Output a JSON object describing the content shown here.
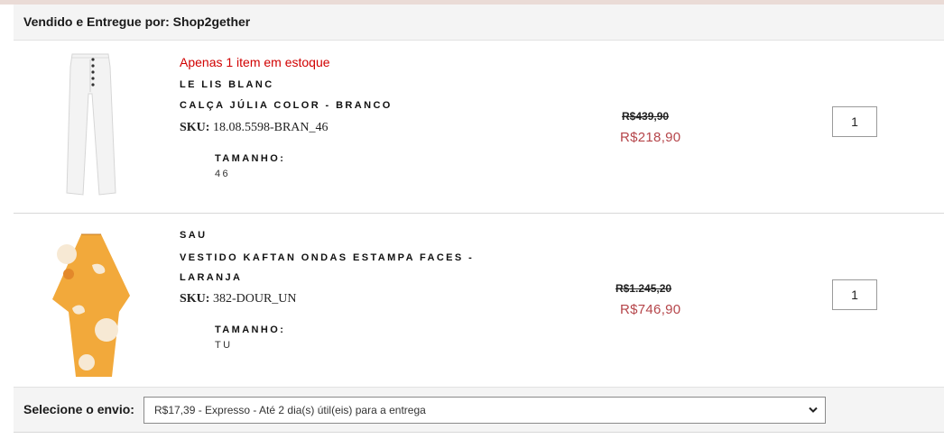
{
  "seller": {
    "label": "Vendido e Entregue por: Shop2gether"
  },
  "items": [
    {
      "stock_message": "Apenas 1 item em estoque",
      "brand": "LE LIS BLANC",
      "name": "CALÇA JÚLIA COLOR - BRANCO",
      "sku_label": "SKU:",
      "sku_value": "18.08.5598-BRAN_46",
      "size_label": "TAMANHO:",
      "size_value": "46",
      "old_price": "R$439,90",
      "new_price": "R$218,90",
      "quantity": "1",
      "image_icon": "white-pants-icon"
    },
    {
      "brand": "SAU",
      "name": "VESTIDO KAFTAN ONDAS ESTAMPA FACES - LARANJA",
      "sku_label": "SKU:",
      "sku_value": "382-DOUR_UN",
      "size_label": "TAMANHO:",
      "size_value": "TU",
      "old_price": "R$1.245,20",
      "new_price": "R$746,90",
      "quantity": "1",
      "image_icon": "orange-kaftan-icon"
    }
  ],
  "shipping": {
    "label": "Selecione o envio:",
    "selected": "R$17,39 - Expresso - Até 2 dia(s) útil(eis) para a entrega"
  },
  "colors": {
    "stock_red": "#d10000",
    "price_red": "#b5454a",
    "bar_bg": "#f4f4f4"
  }
}
